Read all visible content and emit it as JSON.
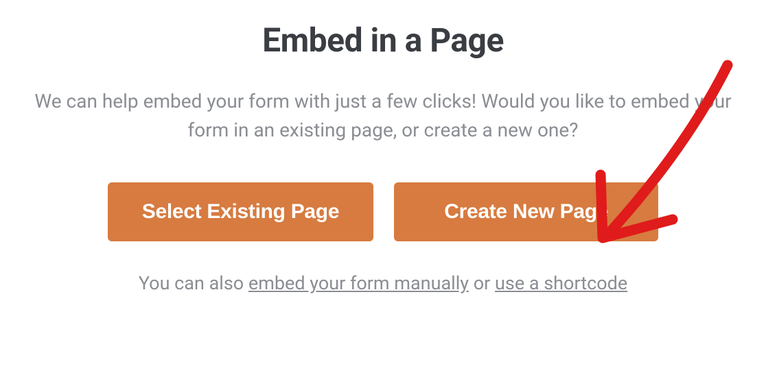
{
  "dialog": {
    "title": "Embed in a Page",
    "subtitle": "We can help embed your form with just a few clicks! Would you like to embed your form in an existing page, or create a new one?",
    "buttons": {
      "select_existing": "Select Existing Page",
      "create_new": "Create New Page"
    },
    "footer": {
      "prefix": "You can also ",
      "link_manual": "embed your form manually",
      "middle": " or ",
      "link_shortcode": "use a shortcode"
    }
  },
  "annotation": {
    "color": "#e01b1b",
    "target": "create-new-page-button"
  }
}
